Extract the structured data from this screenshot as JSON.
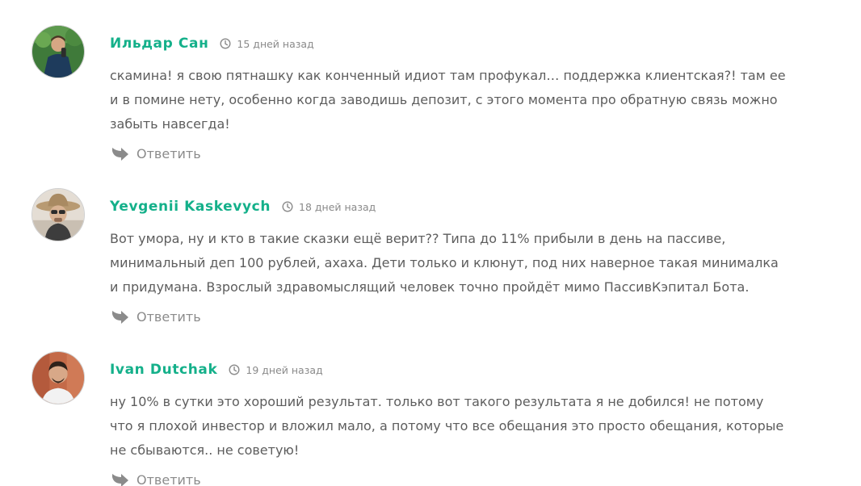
{
  "comments": [
    {
      "author": "Ильдар Сан",
      "time": "15 дней назад",
      "text": "скамина! я свою пятнашку как конченный идиот там профукал… поддержка клиентская?! там ее и в помине нету, особенно когда заводишь депозит, с этого момента про обратную связь можно забыть навсегда!",
      "reply_label": "Ответить"
    },
    {
      "author": "Yevgenii Kaskevych",
      "time": "18 дней назад",
      "text": "Вот умора, ну и кто в такие сказки ещё верит?? Типа до 11% прибыли в день на пассиве, минимальный деп 100 рублей, ахаха. Дети только и клюнут, под них наверное такая минималка и придумана. Взрослый здравомыслящий человек точно пройдёт мимо ПассивКэпитал Бота.",
      "reply_label": "Ответить"
    },
    {
      "author": "Ivan Dutchak",
      "time": "19 дней назад",
      "text": "ну 10% в сутки это хороший результат. только вот такого результата я не добился! не потому что я плохой инвестор и вложил мало, а потому что все обещания это просто обещания, которые не сбываются.. не советую!",
      "reply_label": "Ответить"
    }
  ],
  "colors": {
    "author": "#14b08a",
    "text": "#5d5d5d",
    "meta": "#8a8a8a"
  },
  "icons": {
    "time": "clock-icon",
    "reply": "reply-arrow-icon"
  }
}
